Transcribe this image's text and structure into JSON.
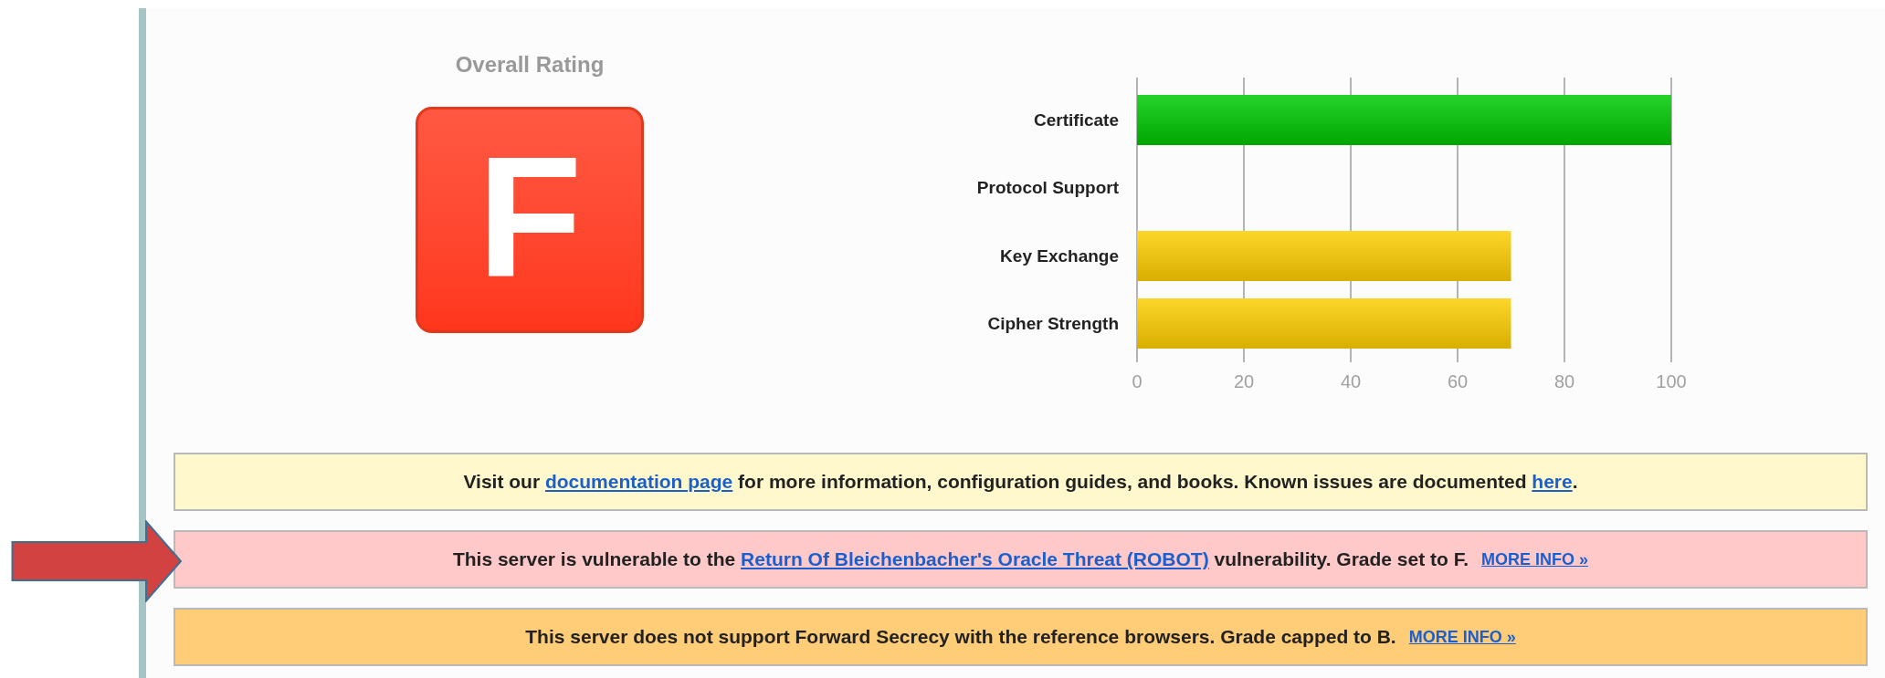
{
  "rating": {
    "title": "Overall Rating",
    "grade": "F"
  },
  "chart_data": {
    "type": "bar",
    "orientation": "horizontal",
    "categories": [
      "Certificate",
      "Protocol Support",
      "Key Exchange",
      "Cipher Strength"
    ],
    "series": [
      {
        "values": [
          100,
          0,
          70,
          70
        ]
      }
    ],
    "xlim": [
      0,
      100
    ],
    "xticks": [
      0,
      20,
      40,
      60,
      80,
      100
    ],
    "grid": true
  },
  "banners": [
    {
      "kind": "info",
      "parts": [
        {
          "kind": "text",
          "text": "Visit our "
        },
        {
          "kind": "link",
          "text": "documentation page"
        },
        {
          "kind": "text",
          "text": " for more information, configuration guides, and books. Known issues are documented "
        },
        {
          "kind": "link",
          "text": "here"
        },
        {
          "kind": "text",
          "text": "."
        }
      ],
      "marked": false
    },
    {
      "kind": "error",
      "parts": [
        {
          "kind": "text",
          "text": "This server is vulnerable to the "
        },
        {
          "kind": "link",
          "text": "Return Of Bleichenbacher's Oracle Threat (ROBOT)"
        },
        {
          "kind": "text",
          "text": " vulnerability. Grade set to F."
        }
      ],
      "more_info": "MORE INFO »",
      "marked": true
    },
    {
      "kind": "warning",
      "parts": [
        {
          "kind": "text",
          "text": "This server does not support Forward Secrecy with the reference browsers. Grade capped to B."
        }
      ],
      "more_info": "MORE INFO »",
      "marked": false
    }
  ]
}
